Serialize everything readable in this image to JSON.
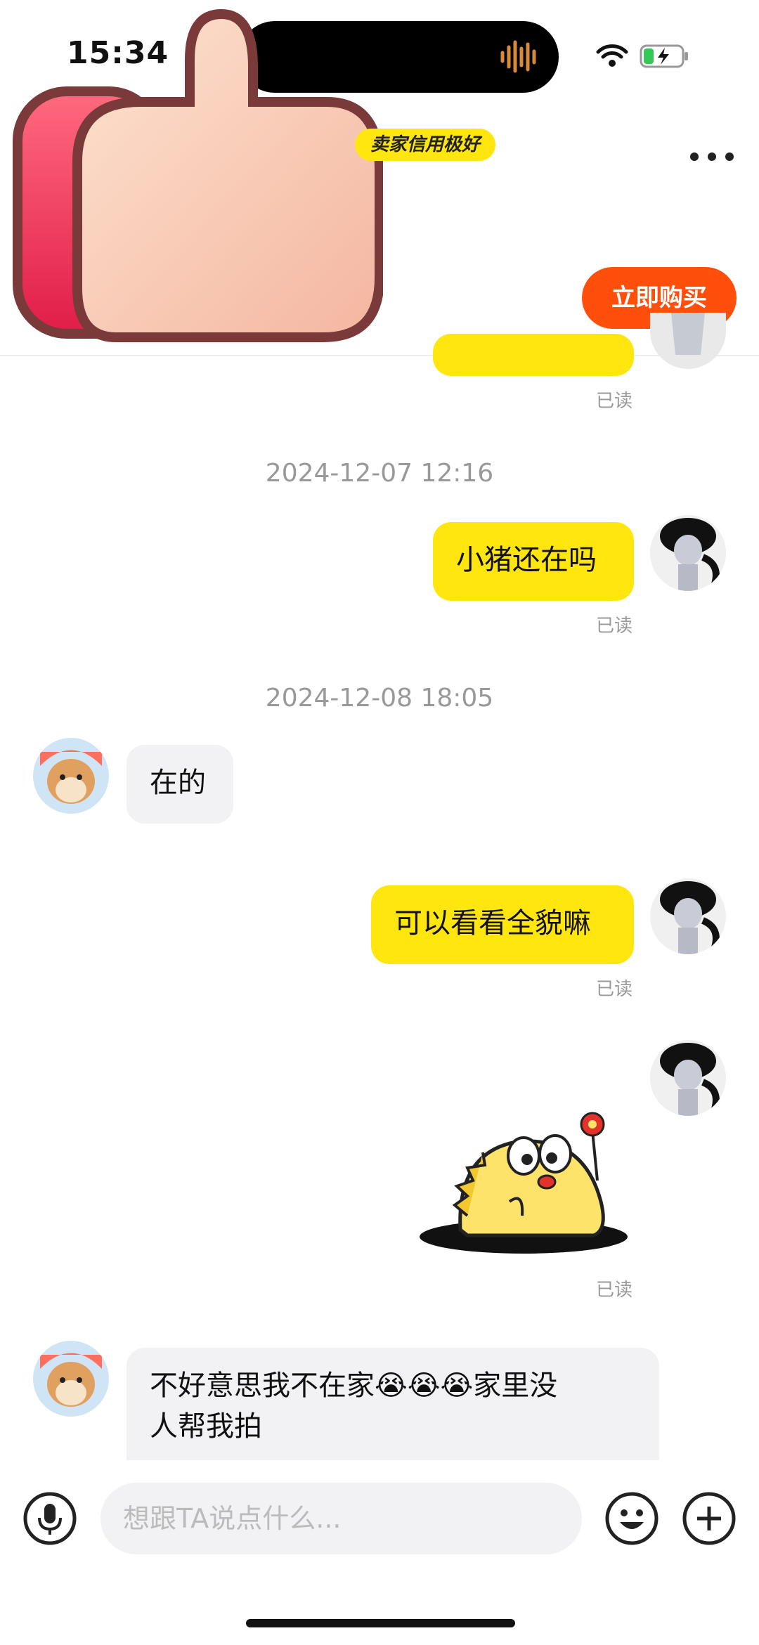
{
  "status": {
    "time": "15:34"
  },
  "header": {
    "seller_badge": "卖家信用极好",
    "buy_label": "立即购买"
  },
  "messages": {
    "m1_read": "已读",
    "ts1": "2024-12-07 12:16",
    "m2_text": "小猪还在吗",
    "m2_read": "已读",
    "ts2": "2024-12-08 18:05",
    "m3_text": "在的",
    "m4_text": "可以看看全貌嘛",
    "m4_read": "已读",
    "m5_read": "已读",
    "m6_text_a": "不好意思我不在家",
    "m6_emoji": "😭😭😭",
    "m6_text_b": "家里没",
    "m6_text_c": "人帮我拍"
  },
  "input": {
    "placeholder": "想跟TA说点什么..."
  },
  "icons": {
    "mic": "microphone-icon",
    "emoji": "emoji-icon",
    "plus": "plus-icon",
    "more": "more-icon"
  },
  "colors": {
    "accent_yellow": "#ffe60f",
    "buy_orange": "#ff4f0b"
  }
}
